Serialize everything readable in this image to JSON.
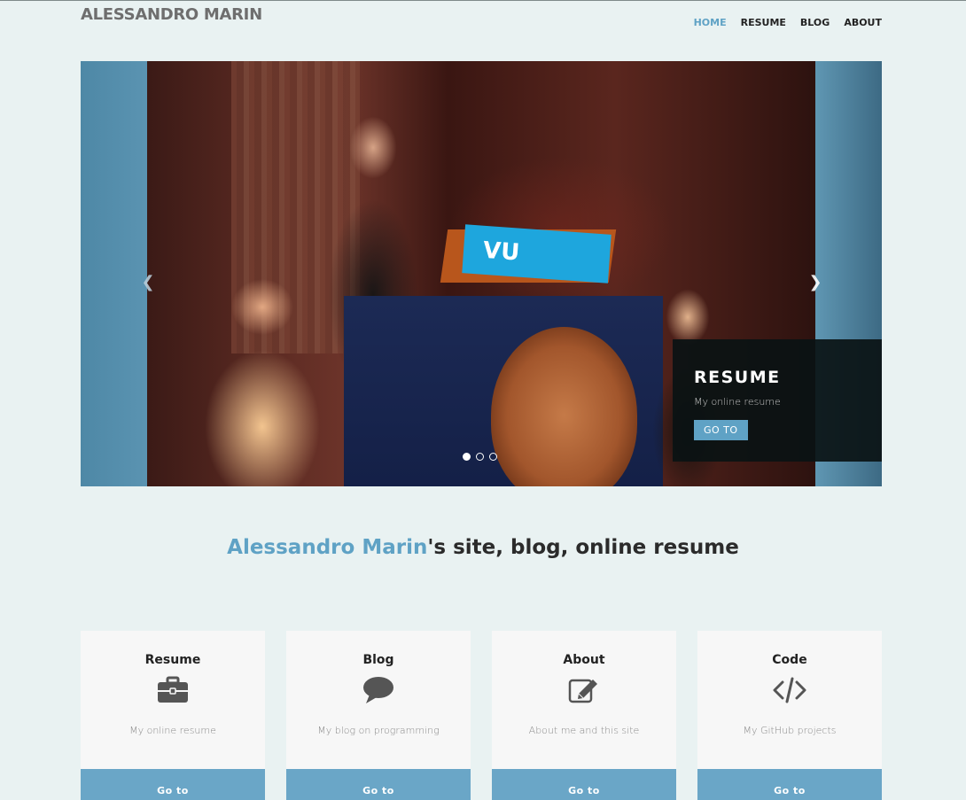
{
  "header": {
    "brand": "ALESSANDRO MARIN",
    "nav": [
      {
        "label": "HOME",
        "active": true
      },
      {
        "label": "RESUME",
        "active": false
      },
      {
        "label": "BLOG",
        "active": false
      },
      {
        "label": "ABOUT",
        "active": false
      }
    ]
  },
  "carousel": {
    "slide_count": 3,
    "active_index": 0,
    "caption": {
      "title": "RESUME",
      "subtitle": "My online resume",
      "button": "GO TO"
    },
    "photo_sign_text": "VU"
  },
  "tagline": {
    "name": "Alessandro Marin",
    "rest": "'s site, blog, online resume"
  },
  "cards": [
    {
      "title": "Resume",
      "icon": "briefcase-icon",
      "desc": "My online resume",
      "button": "Go to"
    },
    {
      "title": "Blog",
      "icon": "speech-bubble-icon",
      "desc": "My blog on programming",
      "button": "Go to"
    },
    {
      "title": "About",
      "icon": "edit-icon",
      "desc": "About me and this site",
      "button": "Go to"
    },
    {
      "title": "Code",
      "icon": "code-icon",
      "desc": "My GitHub projects",
      "button": "Go to"
    }
  ],
  "colors": {
    "accent": "#5fa2c5",
    "background": "#e9f2f2",
    "card": "#f7f7f7"
  }
}
